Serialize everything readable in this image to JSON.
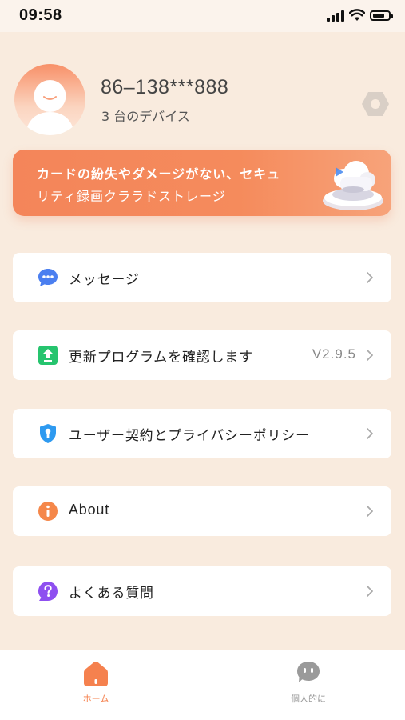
{
  "status_bar": {
    "time": "09:58"
  },
  "profile": {
    "phone": "86–138***888",
    "device_count": "3 台のデバイス"
  },
  "banner": {
    "line1": "カードの紛失やダメージがない、セキュ",
    "line2": "リティ録画クララドストレージ"
  },
  "menu": [
    {
      "label": "メッセージ",
      "icon": "message-icon"
    },
    {
      "label": "更新プログラムを確認します",
      "value": "V2.9.5",
      "icon": "update-icon"
    },
    {
      "label": "ユーザー契約とプライバシーポリシー",
      "icon": "shield-icon"
    },
    {
      "label": "About",
      "icon": "info-icon"
    },
    {
      "label": "よくある質問",
      "icon": "question-icon"
    }
  ],
  "tabbar": {
    "home_label": "ホーム",
    "profile_label": "個人的に"
  },
  "colors": {
    "background": "#f9ebde",
    "accent": "#f5814e",
    "banner": "#f58b5c",
    "card": "#ffffff"
  }
}
